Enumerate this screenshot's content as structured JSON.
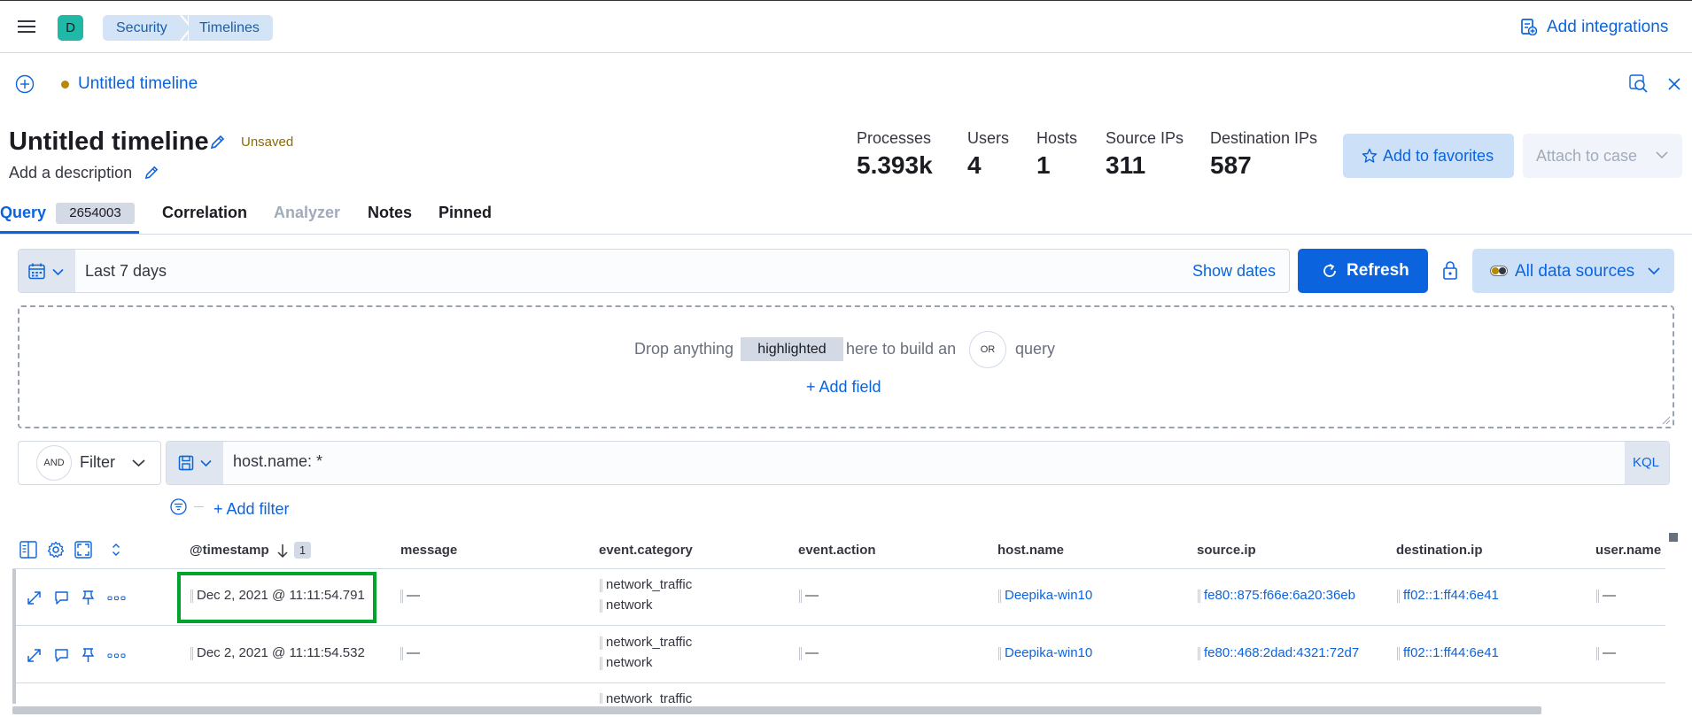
{
  "header": {
    "avatar_letter": "D",
    "breadcrumbs": [
      "Security",
      "Timelines"
    ],
    "add_integrations": "Add integrations"
  },
  "timeline_tab": {
    "title": "Untitled timeline"
  },
  "timeline": {
    "title": "Untitled timeline",
    "status": "Unsaved",
    "description_placeholder": "Add a description",
    "stats": [
      {
        "label": "Processes",
        "value": "5.393k"
      },
      {
        "label": "Users",
        "value": "4"
      },
      {
        "label": "Hosts",
        "value": "1"
      },
      {
        "label": "Source IPs",
        "value": "311"
      },
      {
        "label": "Destination IPs",
        "value": "587"
      }
    ],
    "add_to_favorites": "Add to favorites",
    "attach_to_case": "Attach to case"
  },
  "tabs": {
    "query": "Query",
    "query_count": "2654003",
    "correlation": "Correlation",
    "analyzer": "Analyzer",
    "notes": "Notes",
    "pinned": "Pinned"
  },
  "date_picker": {
    "range": "Last 7 days",
    "show_dates": "Show dates",
    "refresh": "Refresh",
    "data_sources": "All data sources"
  },
  "dropzone": {
    "text_before": "Drop anything",
    "highlight": "highlighted",
    "text_middle": "here to build an",
    "or_badge": "OR",
    "text_after": "query",
    "add_field": "+ Add field"
  },
  "query_bar": {
    "and_badge": "AND",
    "filter_label": "Filter",
    "query_value": "host.name: *",
    "language": "KQL",
    "add_filter": "+ Add filter"
  },
  "table": {
    "sort_count": "1",
    "columns": [
      "@timestamp",
      "message",
      "event.category",
      "event.action",
      "host.name",
      "source.ip",
      "destination.ip",
      "user.name"
    ],
    "rows": [
      {
        "timestamp": "Dec 2, 2021 @ 11:11:54.791",
        "message": "—",
        "category1": "network_traffic",
        "category2": "network",
        "action": "—",
        "host": "Deepika-win10",
        "source_ip": "fe80::875:f66e:6a20:36eb",
        "destination_ip": "ff02::1:ff44:6e41",
        "user": "—"
      },
      {
        "timestamp": "Dec 2, 2021 @ 11:11:54.532",
        "message": "—",
        "category1": "network_traffic",
        "category2": "network",
        "action": "—",
        "host": "Deepika-win10",
        "source_ip": "fe80::468:2dad:4321:72d7",
        "destination_ip": "ff02::1:ff44:6e41",
        "user": "—"
      },
      {
        "category1": "network_traffic"
      }
    ]
  },
  "colors": {
    "primary": "#0b64dd",
    "avatar": "#20b9a8",
    "unsaved": "#8a6a0a",
    "highlight_box": "#00a32b"
  }
}
